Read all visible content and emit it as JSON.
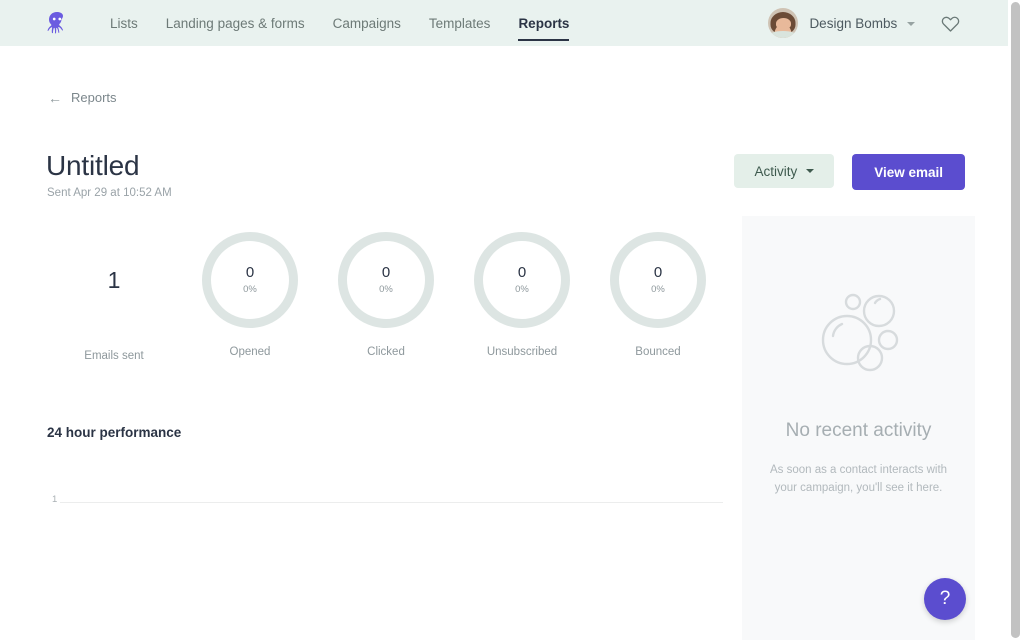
{
  "header": {
    "logo_icon": "octopus-logo",
    "nav": [
      {
        "label": "Lists",
        "active": false
      },
      {
        "label": "Landing pages & forms",
        "active": false
      },
      {
        "label": "Campaigns",
        "active": false
      },
      {
        "label": "Templates",
        "active": false
      },
      {
        "label": "Reports",
        "active": true
      }
    ],
    "user": {
      "name": "Design Bombs",
      "avatar_icon": "user-avatar",
      "caret_icon": "chevron-down-icon"
    },
    "favorites_icon": "heart-icon"
  },
  "page": {
    "back_link": {
      "label": "Reports",
      "icon": "arrow-left-icon"
    },
    "title": "Untitled",
    "subtitle": "Sent Apr 29 at 10:52 AM"
  },
  "actions": {
    "activity_label": "Activity",
    "activity_caret_icon": "chevron-down-icon",
    "view_email_label": "View email"
  },
  "stats": [
    {
      "value": "1",
      "pct": "",
      "label": "Emails sent",
      "type": "plain"
    },
    {
      "value": "0",
      "pct": "0%",
      "label": "Opened",
      "type": "ring"
    },
    {
      "value": "0",
      "pct": "0%",
      "label": "Clicked",
      "type": "ring"
    },
    {
      "value": "0",
      "pct": "0%",
      "label": "Unsubscribed",
      "type": "ring"
    },
    {
      "value": "0",
      "pct": "0%",
      "label": "Bounced",
      "type": "ring"
    }
  ],
  "chart_section": {
    "title": "24 hour performance",
    "y_tick": "1"
  },
  "chart_data": {
    "type": "line",
    "title": "24 hour performance",
    "xlabel": "",
    "ylabel": "",
    "x": [],
    "values": [],
    "yticks": [
      "1"
    ],
    "ylim": [
      0,
      1
    ],
    "grid": true,
    "legend": "none",
    "note": "Empty chart — no data points plotted; a single gridline at y=1"
  },
  "activity_panel": {
    "empty_icon": "bubbles-icon",
    "title": "No recent activity",
    "description": "As soon as a contact interacts with your campaign, you'll see it here."
  },
  "help": {
    "label": "?",
    "icon": "question-mark-icon"
  },
  "colors": {
    "header_bg": "#e9f2ef",
    "accent_purple": "#5b4dcf",
    "activity_btn_bg": "#e4efe9",
    "ring": "#dde5e3",
    "panel_bg": "#f8f9fa",
    "text_dark": "#2b3445",
    "text_muted": "#8e989c"
  }
}
